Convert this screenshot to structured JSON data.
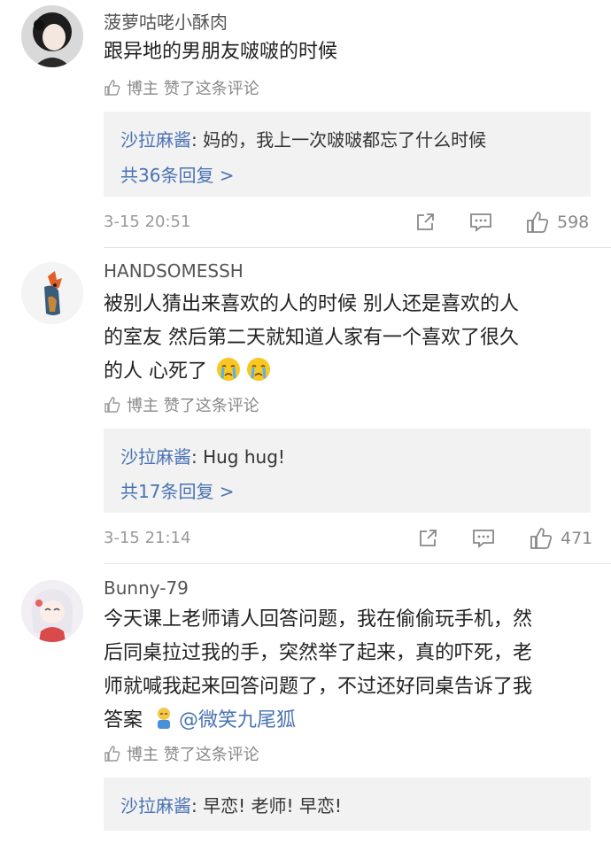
{
  "comments": [
    {
      "username": "菠萝咕咾小酥肉",
      "text": "跟异地的男朋友啵啵的时候",
      "liked_by": "博主 赞了这条评论",
      "reply_author": "沙拉麻酱",
      "reply_text": ": 妈的，我上一次啵啵都忘了什么时候",
      "reply_more": "共36条回复 >",
      "time": "3-15 20:51",
      "likes": "598"
    },
    {
      "username": "HANDSOMESSH",
      "text_lines": [
        "被别人猜出来喜欢的人的时候 别人还是喜欢的人",
        "的室友 然后第二天就知道人家有一个喜欢了很久",
        "的人 心死了"
      ],
      "liked_by": "博主 赞了这条评论",
      "reply_author": "沙拉麻酱",
      "reply_text": ": Hug hug!",
      "reply_more": "共17条回复 >",
      "time": "3-15 21:14",
      "likes": "471"
    },
    {
      "username": "Bunny-79",
      "text_lines": [
        "今天课上老师请人回答问题，我在偷偷玩手机，然",
        "后同桌拉过我的手，突然举了起来，真的吓死，老",
        "师就喊我起来回答问题了，不过还好同桌告诉了我",
        "答案"
      ],
      "mention": "@微笑九尾狐",
      "liked_by": "博主 赞了这条评论",
      "reply_author": "沙拉麻酱",
      "reply_text": ": 早恋! 老师! 早恋!"
    }
  ],
  "icons": {
    "like": "thumb-up-icon",
    "share": "share-icon",
    "comment": "comment-icon"
  },
  "colors": {
    "link": "#4a73b3",
    "reply_bg": "#f2f2f2"
  }
}
